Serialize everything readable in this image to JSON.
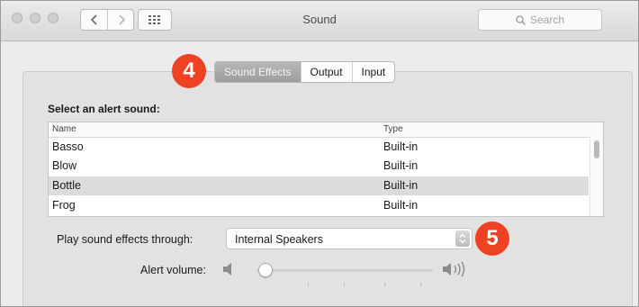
{
  "window": {
    "title": "Sound",
    "search_placeholder": "Search"
  },
  "toolbar": {
    "back_icon": "chevron-left-icon",
    "forward_icon": "chevron-right-icon",
    "show_all_icon": "grid-icon"
  },
  "tabs": [
    {
      "label": "Sound Effects",
      "active": true
    },
    {
      "label": "Output",
      "active": false
    },
    {
      "label": "Input",
      "active": false
    }
  ],
  "callouts": {
    "tabs_number": "4",
    "device_number": "5",
    "color": "#ef4123"
  },
  "sound_effects": {
    "heading": "Select an alert sound:",
    "columns": [
      "Name",
      "Type"
    ],
    "rows": [
      {
        "name": "Basso",
        "type": "Built-in",
        "selected": false
      },
      {
        "name": "Blow",
        "type": "Built-in",
        "selected": false
      },
      {
        "name": "Bottle",
        "type": "Built-in",
        "selected": true
      },
      {
        "name": "Frog",
        "type": "Built-in",
        "selected": false
      }
    ],
    "play_through_label": "Play sound effects through:",
    "play_through_value": "Internal Speakers",
    "alert_volume_label": "Alert volume:",
    "alert_volume_level": 0.03
  },
  "colors": {
    "active_tab": "#a8a8a8",
    "selected_row": "#dcdcdc"
  }
}
